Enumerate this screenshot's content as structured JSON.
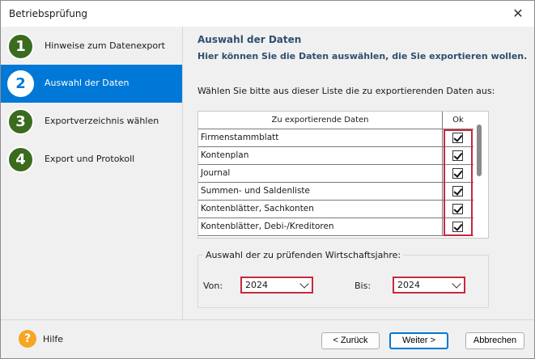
{
  "window": {
    "title": "Betriebsprüfung",
    "close_glyph": "✕"
  },
  "steps": [
    {
      "number": "1",
      "label": "Hinweise zum Datenexport",
      "active": false
    },
    {
      "number": "2",
      "label": "Auswahl der Daten",
      "active": true
    },
    {
      "number": "3",
      "label": "Exportverzeichnis wählen",
      "active": false
    },
    {
      "number": "4",
      "label": "Export und Protokoll",
      "active": false
    }
  ],
  "content": {
    "heading": "Auswahl der Daten",
    "subheading": "Hier können Sie die Daten auswählen, die Sie exportieren wollen.",
    "instruction": "Wählen Sie bitte aus dieser Liste die zu exportierenden Daten aus:"
  },
  "table": {
    "col_name": "Zu exportierende Daten",
    "col_ok": "Ok",
    "rows": [
      {
        "name": "Firmenstammblatt",
        "checked": true
      },
      {
        "name": "Kontenplan",
        "checked": true
      },
      {
        "name": "Journal",
        "checked": true
      },
      {
        "name": "Summen- und Saldenliste",
        "checked": true
      },
      {
        "name": "Kontenblätter, Sachkonten",
        "checked": true
      },
      {
        "name": "Kontenblätter, Debi-/Kreditoren",
        "checked": true
      }
    ]
  },
  "years": {
    "legend": "Auswahl der zu prüfenden Wirtschaftsjahre:",
    "from_label": "Von:",
    "from_value": "2024",
    "to_label": "Bis:",
    "to_value": "2024"
  },
  "footer": {
    "help_glyph": "?",
    "help_label": "Hilfe",
    "back_label": "< Zurück",
    "next_label": "Weiter >",
    "cancel_label": "Abbrechen"
  },
  "colors": {
    "accent": "#0078d7",
    "step_badge": "#3b6b1e",
    "highlight": "#c8283c",
    "help": "#f5a623"
  }
}
